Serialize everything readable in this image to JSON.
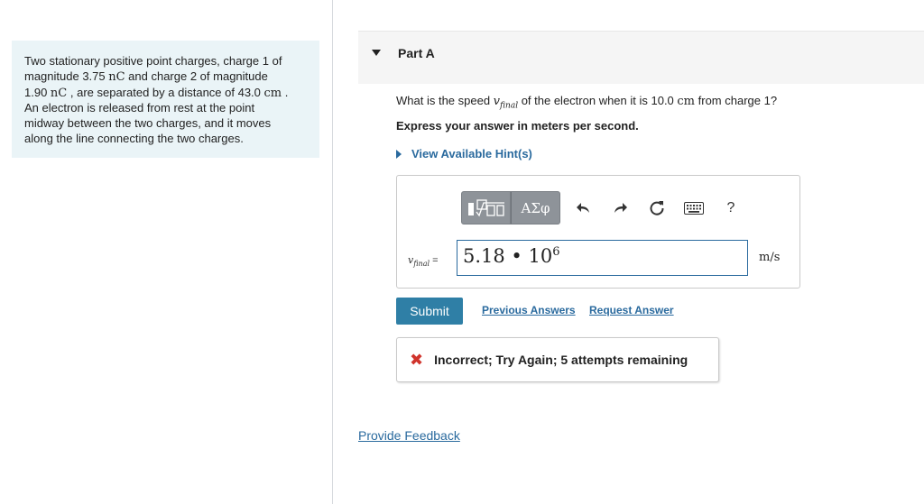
{
  "problem": {
    "line1": "Two stationary positive point charges, charge 1 of",
    "line2_pre": "magnitude 3.75 ",
    "unit_nC": "nC",
    "line2_post": " and charge 2 of magnitude",
    "line3_pre": "1.90 ",
    "line3_post": " , are separated by a distance of 43.0 ",
    "unit_cm": "cm",
    "line3_end": " .",
    "line4": "An electron is released from rest at the point",
    "line5": "midway between the two charges, and it moves",
    "line6": "along the line connecting the two charges."
  },
  "part": {
    "title": "Part A"
  },
  "question": {
    "pre": "What is the speed ",
    "var": "v",
    "sub": "final",
    "mid": " of the electron when it is 10.0 ",
    "unit": "cm",
    "post": " from charge 1?"
  },
  "instruction": "Express your answer in meters per second.",
  "hints_label": "View Available Hint(s)",
  "toolbar": {
    "greek_label": "ΑΣφ",
    "help_label": "?"
  },
  "answer": {
    "var": "v",
    "sub": "final",
    "equals": " =",
    "mantissa": "5.18 • 10",
    "exponent": "6",
    "units": "m/s"
  },
  "submit_label": "Submit",
  "previous_answers_label": "Previous Answers",
  "request_answer_label": "Request Answer",
  "feedback": {
    "icon": "✖",
    "text": "Incorrect; Try Again; 5 attempts remaining"
  },
  "provide_feedback_label": "Provide Feedback",
  "colors": {
    "accent": "#2a6a9e",
    "submit": "#2f7fa6",
    "error": "#d0342c",
    "problem_bg": "#eaf4f7"
  }
}
